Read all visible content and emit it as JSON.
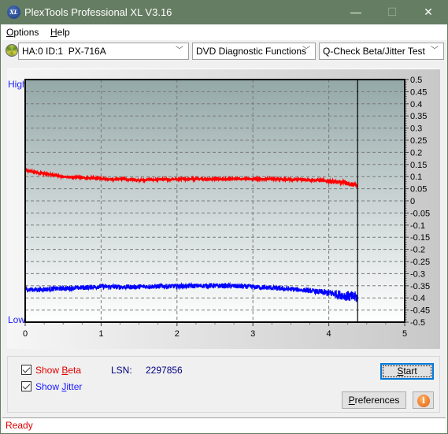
{
  "window": {
    "title": "PlexTools Professional XL V3.16",
    "icon": "xl-logo-icon",
    "minimize_glyph": "—",
    "maximize_glyph": "☐",
    "close_glyph": "✕"
  },
  "menu": {
    "items": [
      {
        "label": "Options",
        "accel": "O",
        "rest": "ptions"
      },
      {
        "label": "Help",
        "accel": "H",
        "rest": "elp"
      }
    ]
  },
  "toolbar": {
    "drive_icon": "disc-icon",
    "drive_select": "HA:0 ID:1  PX-716A",
    "function_select": "DVD Diagnostic Functions",
    "test_select": "Q-Check Beta/Jitter Test",
    "chevron": "﹀"
  },
  "colors": {
    "beta": "#ff0000",
    "jitter": "#0000ff",
    "plot_top": "#94a8a8",
    "plot_bottom": "#ffffff",
    "status_text": "#e00000",
    "lsn_value": "#000080"
  },
  "chart_data": {
    "type": "line",
    "title": "",
    "xlabel": "",
    "ylabel": "",
    "left_axis_labels": {
      "top": "High",
      "bottom": "Low"
    },
    "xlim": [
      0,
      5
    ],
    "ylim": [
      -0.5,
      0.5
    ],
    "x_ticks": [
      "0",
      "1",
      "2",
      "3",
      "4",
      "5"
    ],
    "y_ticks": [
      "0.5",
      "0.45",
      "0.4",
      "0.35",
      "0.3",
      "0.25",
      "0.2",
      "0.15",
      "0.1",
      "0.05",
      "0",
      "-0.05",
      "-0.1",
      "-0.15",
      "-0.2",
      "-0.25",
      "-0.3",
      "-0.35",
      "-0.4",
      "-0.45",
      "-0.5"
    ],
    "grid": true,
    "marker_x": 4.38,
    "series": [
      {
        "name": "Beta",
        "color": "#ff0000",
        "x": [
          0,
          0.1,
          0.2,
          0.3,
          0.5,
          0.7,
          0.9,
          1.1,
          1.3,
          1.5,
          1.7,
          1.9,
          2.1,
          2.3,
          2.5,
          2.7,
          2.9,
          3.1,
          3.3,
          3.5,
          3.7,
          3.9,
          4.0,
          4.1,
          4.2,
          4.3,
          4.38
        ],
        "y": [
          0.125,
          0.12,
          0.115,
          0.11,
          0.1,
          0.096,
          0.093,
          0.09,
          0.09,
          0.086,
          0.087,
          0.088,
          0.09,
          0.09,
          0.09,
          0.09,
          0.09,
          0.09,
          0.089,
          0.088,
          0.087,
          0.085,
          0.082,
          0.078,
          0.075,
          0.068,
          0.062
        ],
        "noise": 0.004
      },
      {
        "name": "Jitter",
        "color": "#0000ff",
        "x": [
          0,
          0.2,
          0.4,
          0.6,
          0.8,
          1.0,
          1.2,
          1.4,
          1.6,
          1.8,
          2.0,
          2.2,
          2.4,
          2.6,
          2.8,
          3.0,
          3.2,
          3.4,
          3.6,
          3.8,
          4.0,
          4.1,
          4.2,
          4.3,
          4.38
        ],
        "y": [
          -0.365,
          -0.366,
          -0.362,
          -0.36,
          -0.357,
          -0.353,
          -0.355,
          -0.355,
          -0.353,
          -0.352,
          -0.352,
          -0.351,
          -0.35,
          -0.35,
          -0.352,
          -0.355,
          -0.358,
          -0.362,
          -0.366,
          -0.372,
          -0.38,
          -0.384,
          -0.39,
          -0.395,
          -0.398
        ],
        "noise": 0.01
      }
    ]
  },
  "controls": {
    "show_beta": {
      "label_pre": "Show ",
      "accel": "B",
      "label_post": "eta",
      "checked": true
    },
    "show_jitter": {
      "label_pre": "Show ",
      "accel": "J",
      "label_post": "itter",
      "checked": true
    },
    "lsn_label": "LSN:",
    "lsn_value": "2297856",
    "start_button": {
      "accel": "S",
      "rest": "tart"
    },
    "preferences_button": {
      "accel": "P",
      "rest": "references"
    },
    "info_icon": "i"
  },
  "status": {
    "text": "Ready"
  }
}
